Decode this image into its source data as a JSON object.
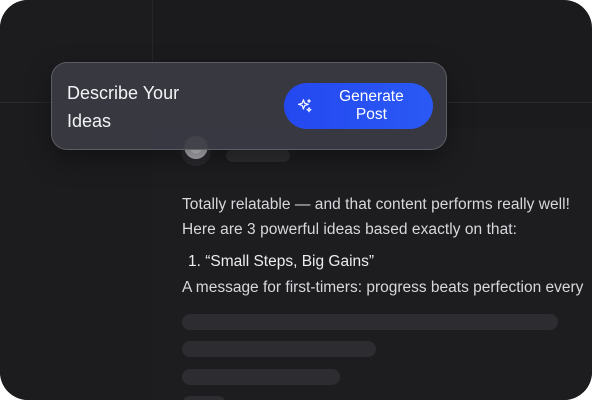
{
  "prompt_card": {
    "label": "Describe Your Ideas",
    "generate_button": {
      "label": "Generate Post",
      "icon": "sparkle-icon"
    }
  },
  "chat": {
    "avatar_icon": "bot-avatar-icon",
    "message_lines": [
      "Totally relatable — and that content performs really well!",
      "Here are 3 powerful ideas based exactly on that:"
    ],
    "ideas": [
      {
        "title": "1. “Small Steps, Big Gains”",
        "description": "A message for first-timers: progress beats perfection every"
      }
    ]
  },
  "colors": {
    "background": "#1b1b1e",
    "accent": "#2448f0",
    "text": "#d8d8dc"
  }
}
